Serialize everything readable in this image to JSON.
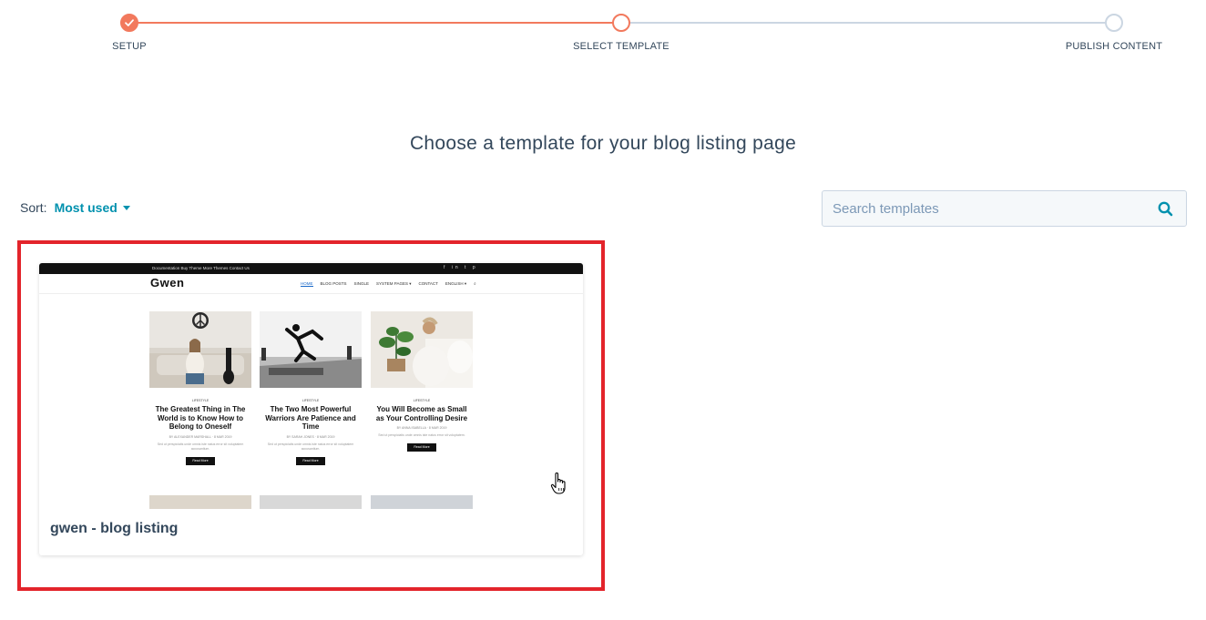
{
  "stepper": {
    "steps": [
      {
        "label": "SETUP",
        "state": "done"
      },
      {
        "label": "SELECT TEMPLATE",
        "state": "active"
      },
      {
        "label": "PUBLISH CONTENT",
        "state": "todo"
      }
    ],
    "accent_color": "#f2795d",
    "inactive_color": "#cbd6e2"
  },
  "heading": "Choose a template for your blog listing page",
  "sort": {
    "label": "Sort:",
    "value": "Most used"
  },
  "search": {
    "placeholder": "Search templates",
    "value": ""
  },
  "templates": [
    {
      "name": "gwen - blog listing",
      "selected": true,
      "preview": {
        "top_links": "Documentation   Buy Theme   More Themes   Contact Us",
        "logo": "Gwen",
        "menu": [
          "HOME",
          "BLOG POSTS",
          "SINGLE",
          "SYSTEM PAGES ▾",
          "CONTACT",
          "ENGLISH ▾"
        ],
        "posts": [
          {
            "category": "LIFESTYLE",
            "title": "The Greatest Thing in The World is to Know How to Belong to Oneself",
            "meta": "BY ALEXANDER MARSHALL  ·  8 MAR 2019",
            "excerpt": "Sed ut perspiciatis unde omnis iste natus error sit voluptatem accusantium.",
            "button": "Read More"
          },
          {
            "category": "LIFESTYLE",
            "title": "The Two Most Powerful Warriors Are Patience and Time",
            "meta": "BY SARAH JONES  ·  8 MAR 2019",
            "excerpt": "Sed ut perspiciatis unde omnis iste natus error sit voluptatem accusantium.",
            "button": "Read More"
          },
          {
            "category": "LIFESTYLE",
            "title": "You Will Become as Small as Your Controlling Desire",
            "meta": "BY ANNA ISABELLA  ·  8 MAR 2019",
            "excerpt": "Sed ut perspiciatis unde omnis iste natus error sit voluptatem.",
            "button": "Read More"
          }
        ]
      }
    }
  ],
  "colors": {
    "link": "#0091ae",
    "text": "#33475b",
    "selection_border": "#e3242b"
  }
}
